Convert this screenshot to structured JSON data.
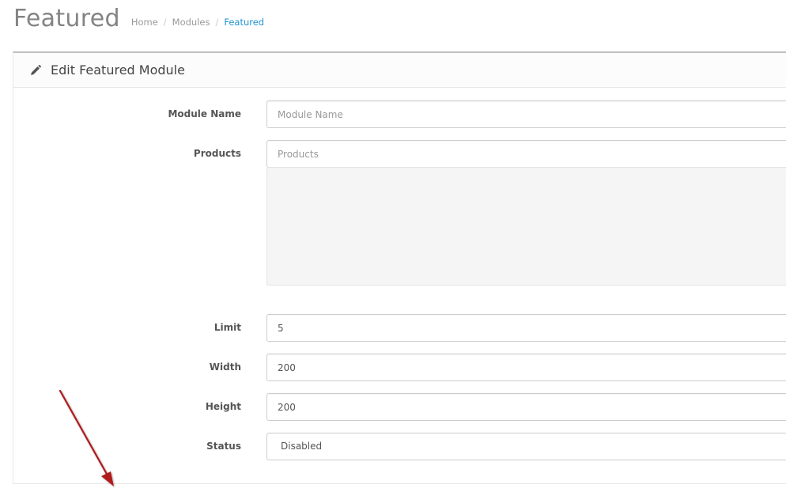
{
  "header": {
    "title": "Featured",
    "breadcrumb": [
      {
        "label": "Home"
      },
      {
        "label": "Modules"
      },
      {
        "label": "Featured"
      }
    ],
    "breadcrumb_separator": "/"
  },
  "panel": {
    "title": "Edit Featured Module",
    "icon": "pencil-icon"
  },
  "form": {
    "module_name": {
      "label": "Module Name",
      "value": "",
      "placeholder": "Module Name"
    },
    "products": {
      "label": "Products",
      "value": "",
      "placeholder": "Products"
    },
    "limit": {
      "label": "Limit",
      "value": "5"
    },
    "width": {
      "label": "Width",
      "value": "200"
    },
    "height": {
      "label": "Height",
      "value": "200"
    },
    "status": {
      "label": "Status",
      "selected": "Disabled"
    }
  },
  "colors": {
    "link_active": "#1e91cf",
    "annotation_arrow": "#b01c1c"
  }
}
